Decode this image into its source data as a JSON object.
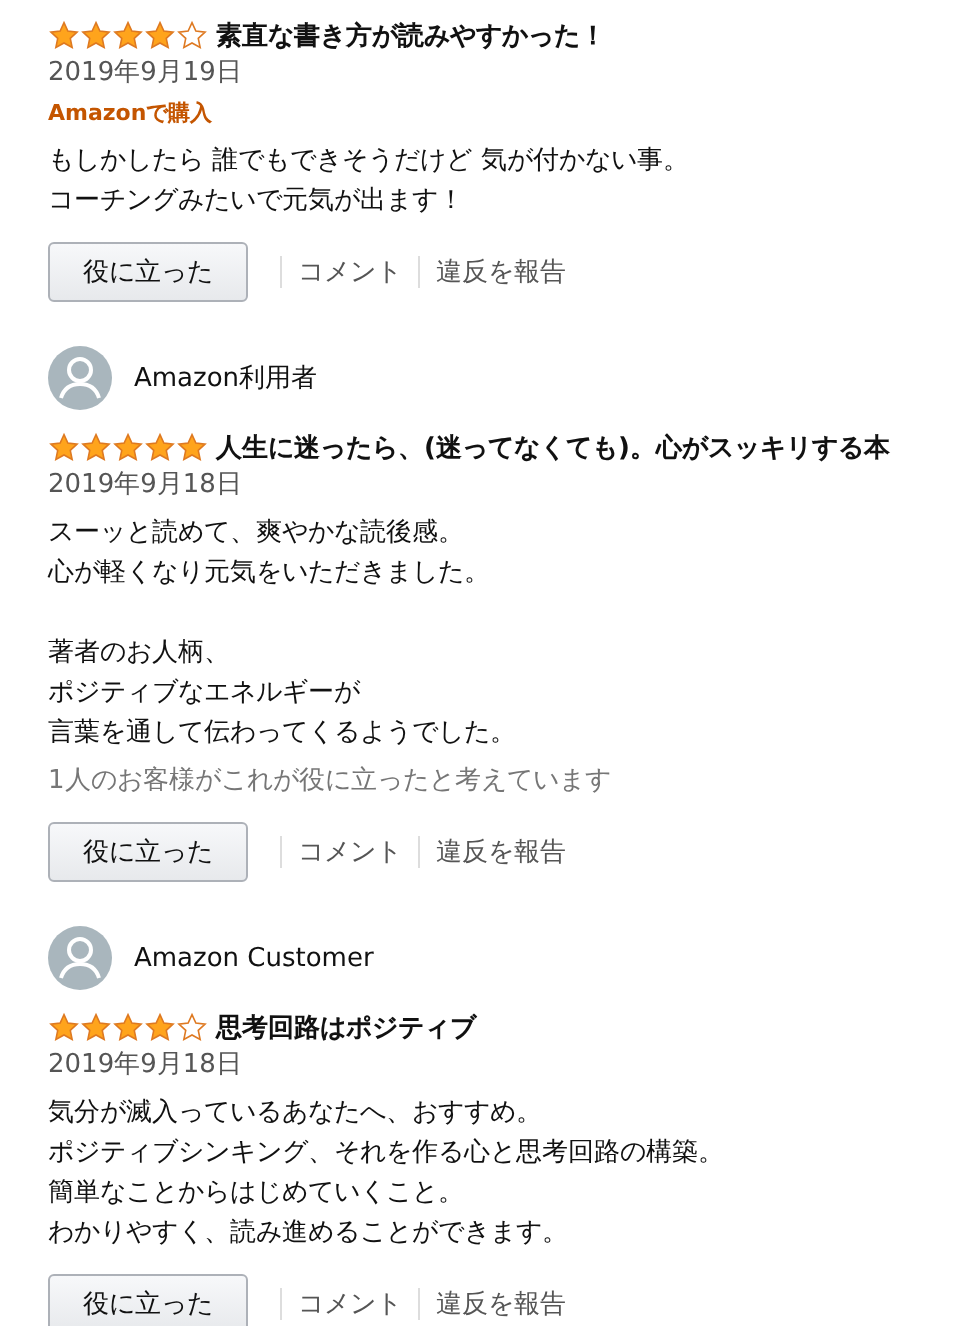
{
  "reviews": [
    {
      "stars": 4,
      "title": "素直な書き方が読みやすかった！",
      "date": "2019年9月19日",
      "badge": "Amazonで購入",
      "paragraphs": [
        [
          "もしかしたら 誰でもできそうだけど 気が付かない事。",
          "コーチングみたいで元気が出ます！"
        ]
      ],
      "actions": {
        "helpful": "役に立った",
        "comment": "コメント",
        "report": "違反を報告"
      }
    },
    {
      "reviewer": "Amazon利用者",
      "stars": 5,
      "title": "人生に迷ったら、(迷ってなくても)。心がスッキリする本",
      "date": "2019年9月18日",
      "paragraphs": [
        [
          "スーッと読めて、爽やかな読後感。",
          "心が軽くなり元気をいただきました。"
        ],
        [
          "著者のお人柄、",
          "ポジティブなエネルギーが",
          "言葉を通して伝わってくるようでした。"
        ]
      ],
      "helpful_count": "1人のお客様がこれが役に立ったと考えています",
      "actions": {
        "helpful": "役に立った",
        "comment": "コメント",
        "report": "違反を報告"
      }
    },
    {
      "reviewer": "Amazon Customer",
      "stars": 4,
      "title": "思考回路はポジティブ",
      "date": "2019年9月18日",
      "paragraphs": [
        [
          "気分が滅入っているあなたへ、おすすめ。",
          "ポジティブシンキング、それを作る心と思考回路の構築。",
          "簡単なことからはじめていくこと。",
          "わかりやすく、読み進めることができます。"
        ]
      ],
      "actions": {
        "helpful": "役に立った",
        "comment": "コメント",
        "report": "違反を報告"
      }
    }
  ]
}
